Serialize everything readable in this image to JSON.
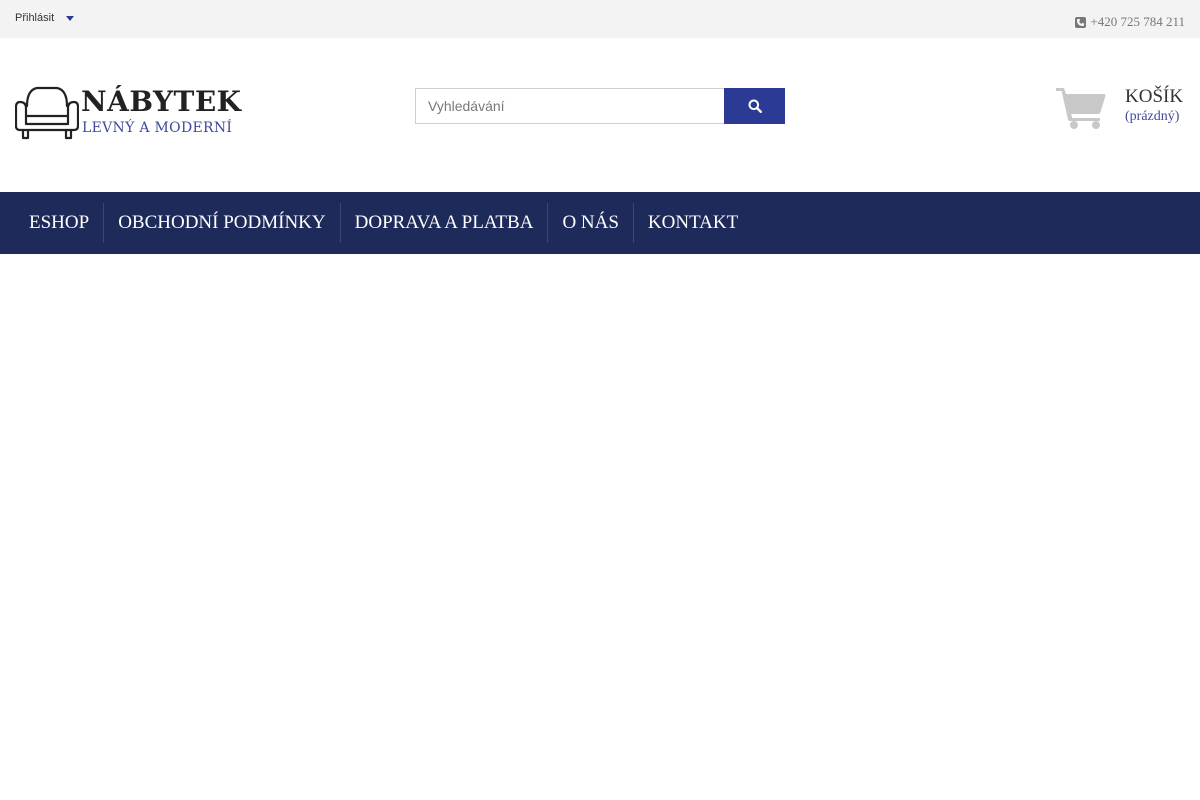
{
  "topbar": {
    "login_label": "Přihlásit",
    "phone": "+420 725 784 211"
  },
  "logo": {
    "title": "NÁBYTEK",
    "subtitle": "LEVNÝ A MODERNÍ"
  },
  "search": {
    "placeholder": "Vyhledávání",
    "value": ""
  },
  "cart": {
    "title": "KOŠÍK",
    "status": "(prázdný)"
  },
  "nav": {
    "items": [
      {
        "label": "ESHOP"
      },
      {
        "label": "OBCHODNÍ PODMÍNKY"
      },
      {
        "label": "DOPRAVA A PLATBA"
      },
      {
        "label": "O NÁS"
      },
      {
        "label": "KONTAKT"
      }
    ]
  },
  "colors": {
    "accent": "#2b3b95",
    "nav_bg": "#1e2a5a",
    "topbar_bg": "#f3f3f3"
  },
  "icons": [
    "chevron-down-icon",
    "phone-icon",
    "armchair-logo-icon",
    "search-icon",
    "shopping-cart-icon"
  ]
}
